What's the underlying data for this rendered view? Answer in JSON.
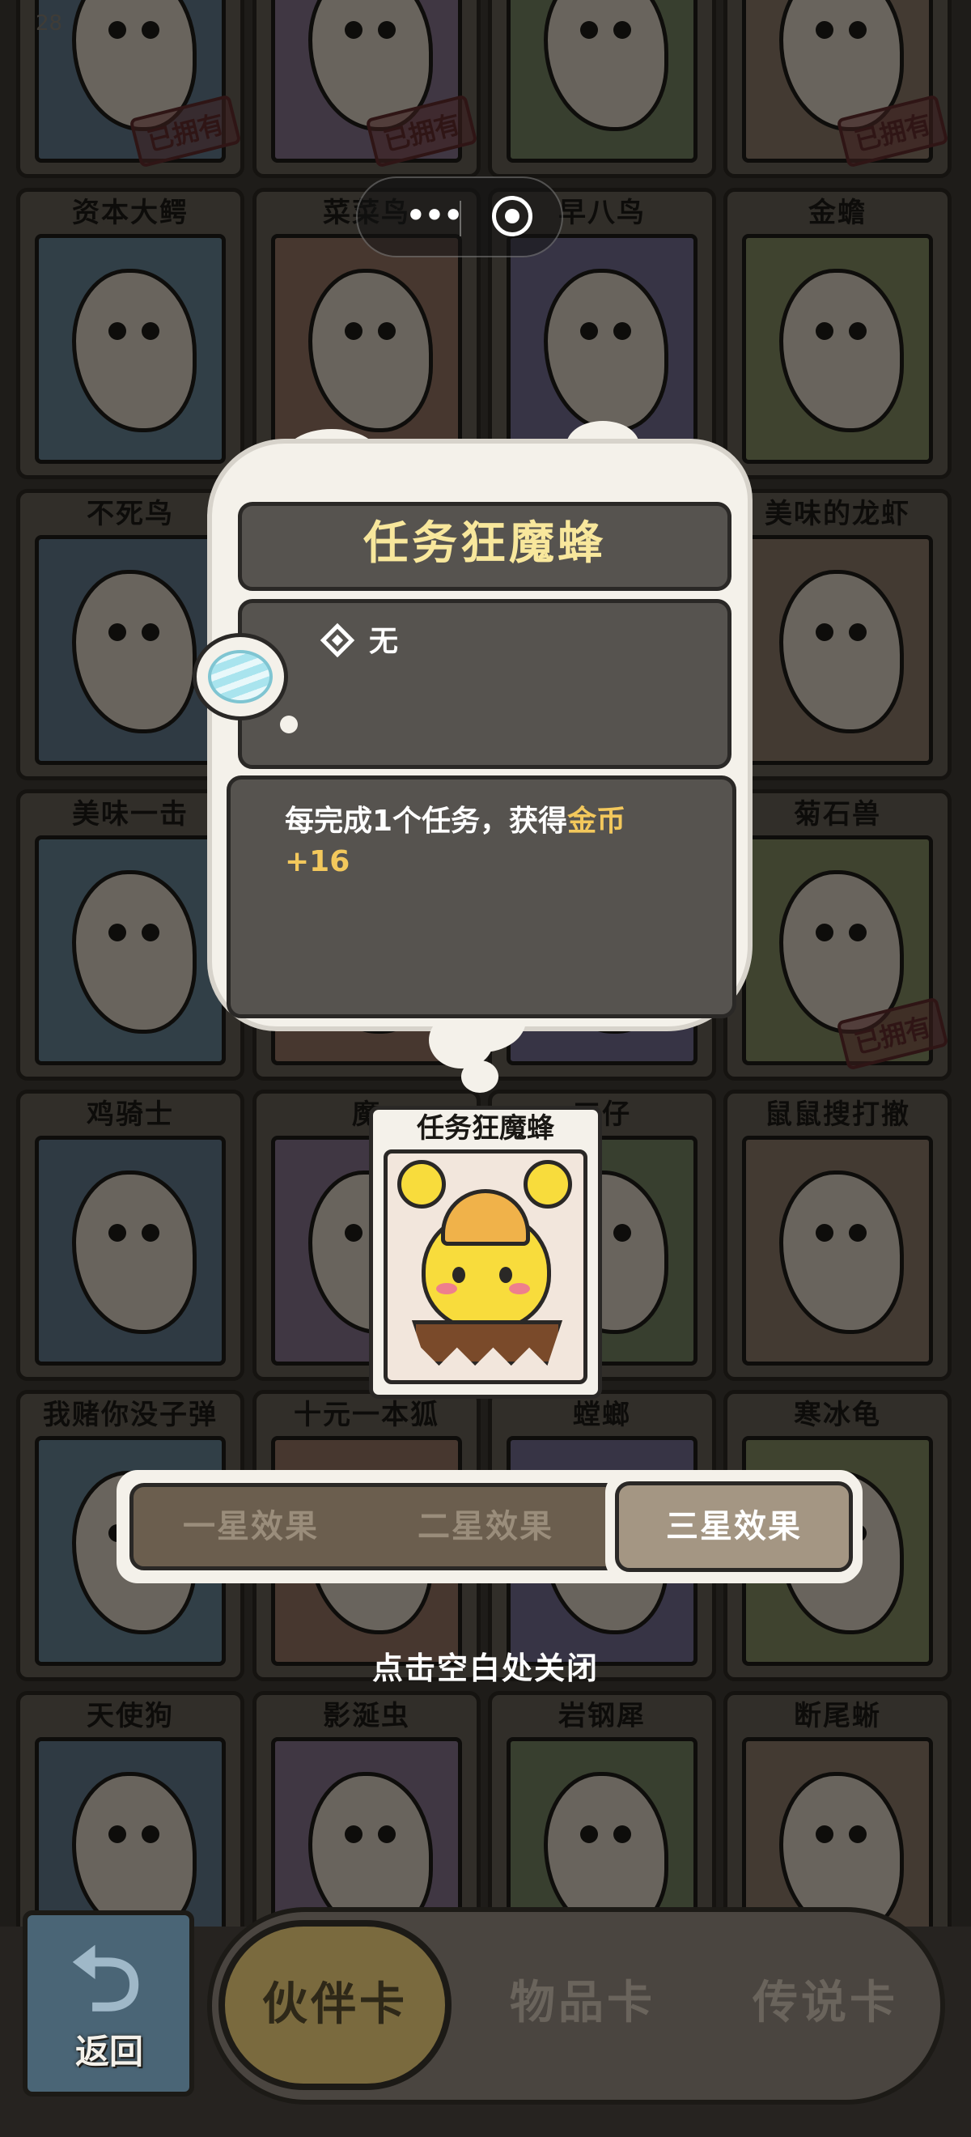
{
  "capsule": {
    "more_glyph": "•••"
  },
  "grid": {
    "row0": [
      {
        "name": "",
        "owned": true
      },
      {
        "name": "",
        "owned": true
      },
      {
        "name": "",
        "owned": false
      },
      {
        "name": "",
        "owned": true
      }
    ],
    "row1": [
      {
        "name": "资本大鳄",
        "owned": false
      },
      {
        "name": "菜菜鸟",
        "owned": false
      },
      {
        "name": "早八鸟",
        "owned": false
      },
      {
        "name": "金蟾",
        "owned": false
      }
    ],
    "row2": [
      {
        "name": "不死鸟",
        "owned": false
      },
      {
        "name": "",
        "owned": false
      },
      {
        "name": "",
        "owned": false
      },
      {
        "name": "美味的龙虾",
        "owned": false
      }
    ],
    "row3": [
      {
        "name": "美味一击",
        "owned": false
      },
      {
        "name": "",
        "owned": false
      },
      {
        "name": "",
        "owned": false
      },
      {
        "name": "菊石兽",
        "owned": true
      }
    ],
    "row4": [
      {
        "name": "鸡骑士",
        "owned": false
      },
      {
        "name": "魔",
        "owned": false
      },
      {
        "name": "工仔",
        "owned": false
      },
      {
        "name": "鼠鼠搜打撤",
        "owned": false
      }
    ],
    "row5": [
      {
        "name": "我赌你没子弹",
        "owned": false
      },
      {
        "name": "十元一本狐",
        "owned": false
      },
      {
        "name": "螳螂",
        "owned": false
      },
      {
        "name": "寒冰龟",
        "owned": false
      }
    ],
    "row6": [
      {
        "name": "天使狗",
        "owned": false
      },
      {
        "name": "影涎虫",
        "owned": false
      },
      {
        "name": "岩钢犀",
        "owned": false
      },
      {
        "name": "断尾蜥",
        "owned": false
      }
    ],
    "owned_label": "已拥有",
    "page_number": "28"
  },
  "popup": {
    "title": "任务狂魔蜂",
    "condition": "无",
    "desc_prefix": "每完成1个任务，获得",
    "desc_highlight": "金币",
    "desc_value": "+16"
  },
  "hero_card": {
    "name": "任务狂魔蜂"
  },
  "star_tabs": {
    "one": "一星效果",
    "two": "二星效果",
    "three": "三星效果",
    "selected": "three"
  },
  "close_hint": "点击空白处关闭",
  "bottom": {
    "back_label": "返回",
    "tabs": [
      "伙伴卡",
      "物品卡",
      "传说卡"
    ],
    "selected_tab": "伙伴卡"
  },
  "colors": {
    "title_yellow": "#f8e79c",
    "gold": "#f3c85c",
    "panel_gray": "#56534f",
    "bubble_white": "#f4f1ea"
  }
}
